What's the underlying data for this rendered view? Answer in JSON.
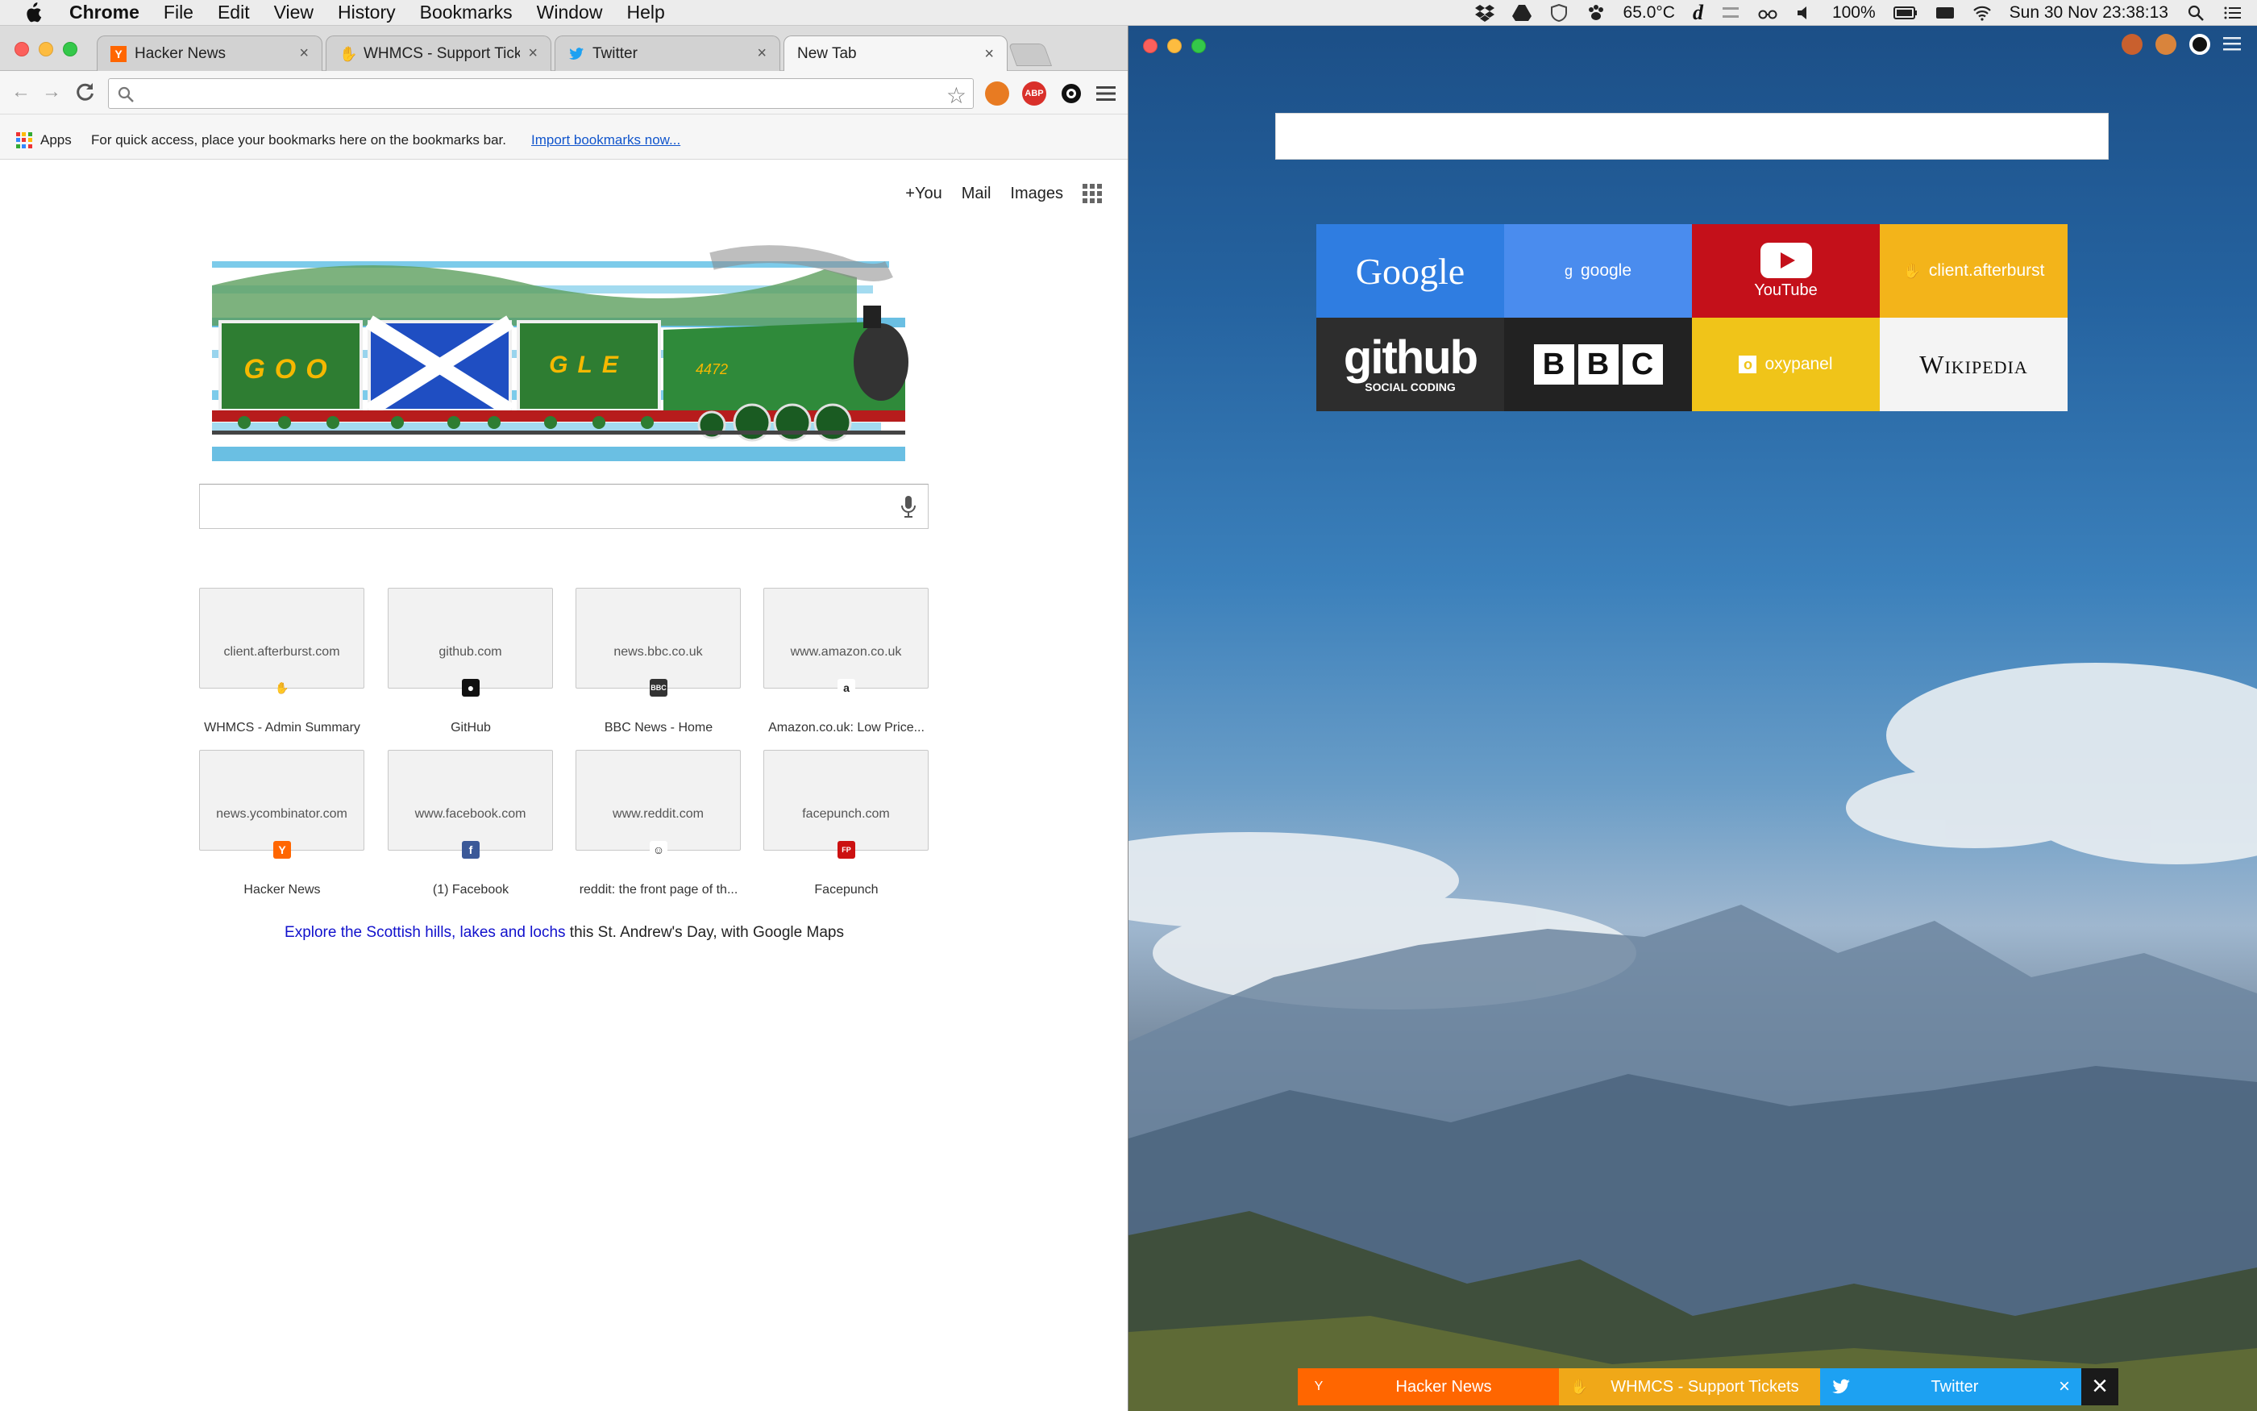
{
  "menubar": {
    "items": [
      "Chrome",
      "File",
      "Edit",
      "View",
      "History",
      "Bookmarks",
      "Window",
      "Help"
    ],
    "temperature": "65.0°C",
    "battery": "100%",
    "datetime": "Sun 30 Nov  23:38:13"
  },
  "left": {
    "tabs": [
      {
        "label": "Hacker News",
        "color": "#ff6600"
      },
      {
        "label": "WHMCS - Support Tickets",
        "color": "#f5c000"
      },
      {
        "label": "Twitter",
        "color": "#1da1f2"
      },
      {
        "label": "New Tab",
        "color": ""
      }
    ],
    "bookmarks": {
      "apps_label": "Apps",
      "hint": "For quick access, place your bookmarks here on the bookmarks bar.",
      "import_link": "Import bookmarks now..."
    },
    "ntp_links": {
      "you": "+You",
      "mail": "Mail",
      "images": "Images"
    },
    "doodle": {
      "left_text": "GOO",
      "right_text": "GLE",
      "loco_number": "4472"
    },
    "tiles": [
      {
        "domain": "client.afterburst.com",
        "title": "WHMCS - Admin Summary",
        "fav": "hand-icon",
        "fav_color": "#f5c000",
        "fav_char": "✋"
      },
      {
        "domain": "github.com",
        "title": "GitHub",
        "fav": "github-icon",
        "fav_color": "#111111",
        "fav_char": "●"
      },
      {
        "domain": "news.bbc.co.uk",
        "title": "BBC News - Home",
        "fav": "bbc-icon",
        "fav_color": "#333333",
        "fav_char": "BBC"
      },
      {
        "domain": "www.amazon.co.uk",
        "title": "Amazon.co.uk: Low Price...",
        "fav": "amazon-icon",
        "fav_color": "#ffffff",
        "fav_char": "a"
      },
      {
        "domain": "news.ycombinator.com",
        "title": "Hacker News",
        "fav": "ycombinator-icon",
        "fav_color": "#ff6600",
        "fav_char": "Y"
      },
      {
        "domain": "www.facebook.com",
        "title": "(1) Facebook",
        "fav": "facebook-icon",
        "fav_color": "#3b5998",
        "fav_char": "f"
      },
      {
        "domain": "www.reddit.com",
        "title": "reddit: the front page of th...",
        "fav": "reddit-icon",
        "fav_color": "#ffffff",
        "fav_char": "☺"
      },
      {
        "domain": "facepunch.com",
        "title": "Facepunch",
        "fav": "facepunch-icon",
        "fav_color": "#cc1111",
        "fav_char": "FP"
      }
    ],
    "promo": {
      "link": "Explore the Scottish hills, lakes and lochs",
      "rest": " this St. Andrew's Day, with Google Maps"
    }
  },
  "right": {
    "speed_dials": [
      {
        "label": "Google",
        "color": "#2f7de1",
        "style": "big"
      },
      {
        "label": "google",
        "color": "#4a8cee",
        "style": "small",
        "icon": "g"
      },
      {
        "label": "YouTube",
        "color": "#c4101a",
        "style": "youtube"
      },
      {
        "label": "client.afterburst",
        "color": "#f3b41a",
        "style": "small",
        "icon": "✋"
      },
      {
        "label": "github",
        "sub": "SOCIAL CODING",
        "color": "#2d2d2d",
        "style": "github"
      },
      {
        "label": "BBC",
        "color": "#222222",
        "style": "bbc"
      },
      {
        "label": "oxypanel",
        "color": "#f0c419",
        "style": "small",
        "icon": "o"
      },
      {
        "label": "Wikipedia",
        "color": "#f4f4f4",
        "style": "wiki"
      }
    ],
    "bottom_tabs": [
      {
        "label": "Hacker News",
        "color": "#ff6600",
        "icon": "Y"
      },
      {
        "label": "WHMCS - Support Tickets",
        "color": "#f0a818",
        "icon": "✋"
      },
      {
        "label": "Twitter",
        "color": "#1da1f2",
        "icon": "🐦"
      }
    ]
  }
}
